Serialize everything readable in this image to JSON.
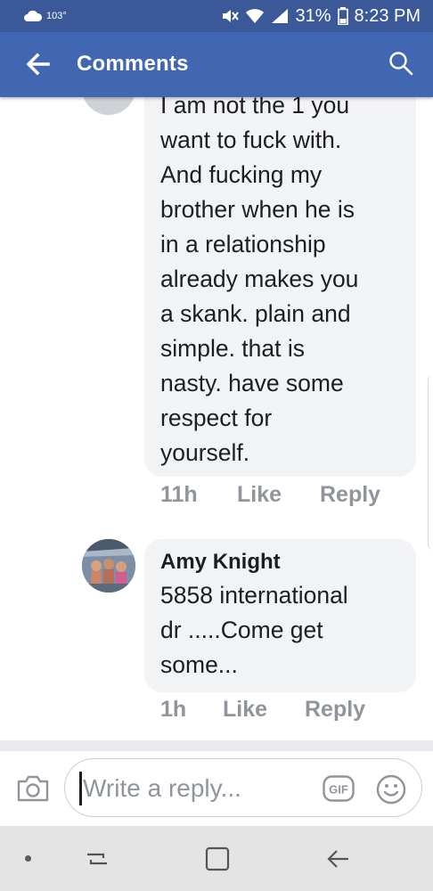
{
  "status_bar": {
    "temperature": "103°",
    "battery": "31%",
    "time": "8:23 PM"
  },
  "header": {
    "title": "Comments"
  },
  "comments": [
    {
      "text_lines": [
        "I am not the 1  you",
        "want to fuck with.",
        "And fucking my",
        "brother when he is",
        "in a relationship",
        "already makes you",
        "a skank. plain and",
        "simple. that is",
        "nasty. have some",
        "respect  for",
        "yourself."
      ],
      "time": "11h",
      "like_label": "Like",
      "reply_label": "Reply"
    },
    {
      "author": "Amy Knight",
      "text_lines": [
        "5858 international",
        "dr  .....Come get",
        "some..."
      ],
      "time": "1h",
      "like_label": "Like",
      "reply_label": "Reply"
    }
  ],
  "composer": {
    "placeholder": "Write a reply...",
    "gif_label": "GIF"
  },
  "colors": {
    "navbar": "#4267b2",
    "statusbar": "#3b5998",
    "bubble": "#f2f3f5",
    "meta": "#90949c"
  },
  "icons": [
    "cloud-icon",
    "mute-icon",
    "wifi-icon",
    "signal-icon",
    "battery-icon",
    "back-arrow-icon",
    "search-icon",
    "camera-icon",
    "gif-icon",
    "emoji-icon",
    "recent-apps-icon",
    "home-icon",
    "back-icon"
  ]
}
